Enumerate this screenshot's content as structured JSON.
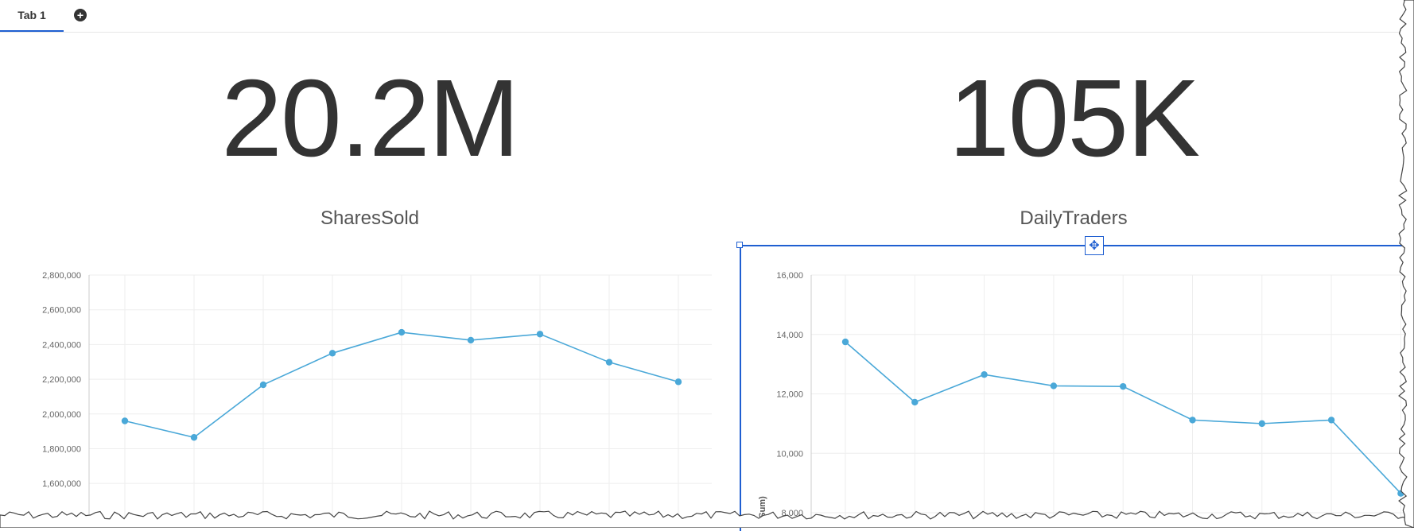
{
  "tabs": [
    {
      "label": "Tab 1",
      "active": true
    }
  ],
  "add_tab_symbol": "+",
  "kpis": [
    {
      "value": "20.2M",
      "label": "SharesSold"
    },
    {
      "value": "105K",
      "label": "DailyTraders"
    }
  ],
  "colors": {
    "accent": "#1f5fd1",
    "series": "#4aa8d8",
    "text": "#333333"
  },
  "move_icon": "move-arrows-icon",
  "chart_data": [
    {
      "type": "line",
      "title": "",
      "xlabel": "",
      "ylabel": "",
      "x": [
        1,
        2,
        3,
        4,
        5,
        6,
        7,
        8,
        9
      ],
      "ylim": [
        1500000,
        2800000
      ],
      "yticks": [
        1600000,
        1800000,
        2000000,
        2200000,
        2400000,
        2600000,
        2800000
      ],
      "ytick_labels": [
        "1,600,000",
        "1,800,000",
        "2,000,000",
        "2,200,000",
        "2,400,000",
        "2,600,000",
        "2,800,000"
      ],
      "series": [
        {
          "values": [
            1960000,
            1865000,
            2168000,
            2350000,
            2470000,
            2425000,
            2460000,
            2298000,
            2185000
          ]
        }
      ],
      "grid": true
    },
    {
      "type": "line",
      "title": "",
      "xlabel": "",
      "ylabel": "ers (Sum)",
      "x": [
        1,
        2,
        3,
        4,
        5,
        6,
        7,
        8,
        9
      ],
      "ylim": [
        8000,
        16000
      ],
      "yticks": [
        8000,
        10000,
        12000,
        14000,
        16000
      ],
      "ytick_labels": [
        "8,000",
        "10,000",
        "12,000",
        "14,000",
        "16,000"
      ],
      "series": [
        {
          "values": [
            13750,
            11720,
            12650,
            12270,
            12250,
            11120,
            11000,
            11120,
            8650
          ]
        }
      ],
      "grid": true
    }
  ]
}
